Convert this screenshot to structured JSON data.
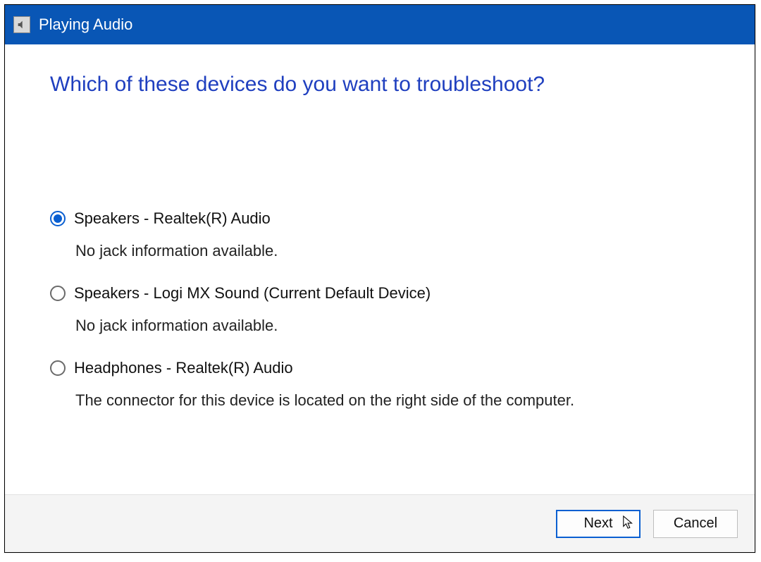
{
  "titlebar": {
    "title": "Playing Audio",
    "icon": "speaker-icon"
  },
  "heading": "Which of these devices do you want to troubleshoot?",
  "options": [
    {
      "label": "Speakers - Realtek(R) Audio",
      "desc": "No jack information available.",
      "selected": true
    },
    {
      "label": "Speakers - Logi MX Sound (Current Default Device)",
      "desc": "No jack information available.",
      "selected": false
    },
    {
      "label": "Headphones - Realtek(R) Audio",
      "desc": "The connector for this device is located on the right side of the computer.",
      "selected": false
    }
  ],
  "buttons": {
    "next": "Next",
    "cancel": "Cancel"
  }
}
